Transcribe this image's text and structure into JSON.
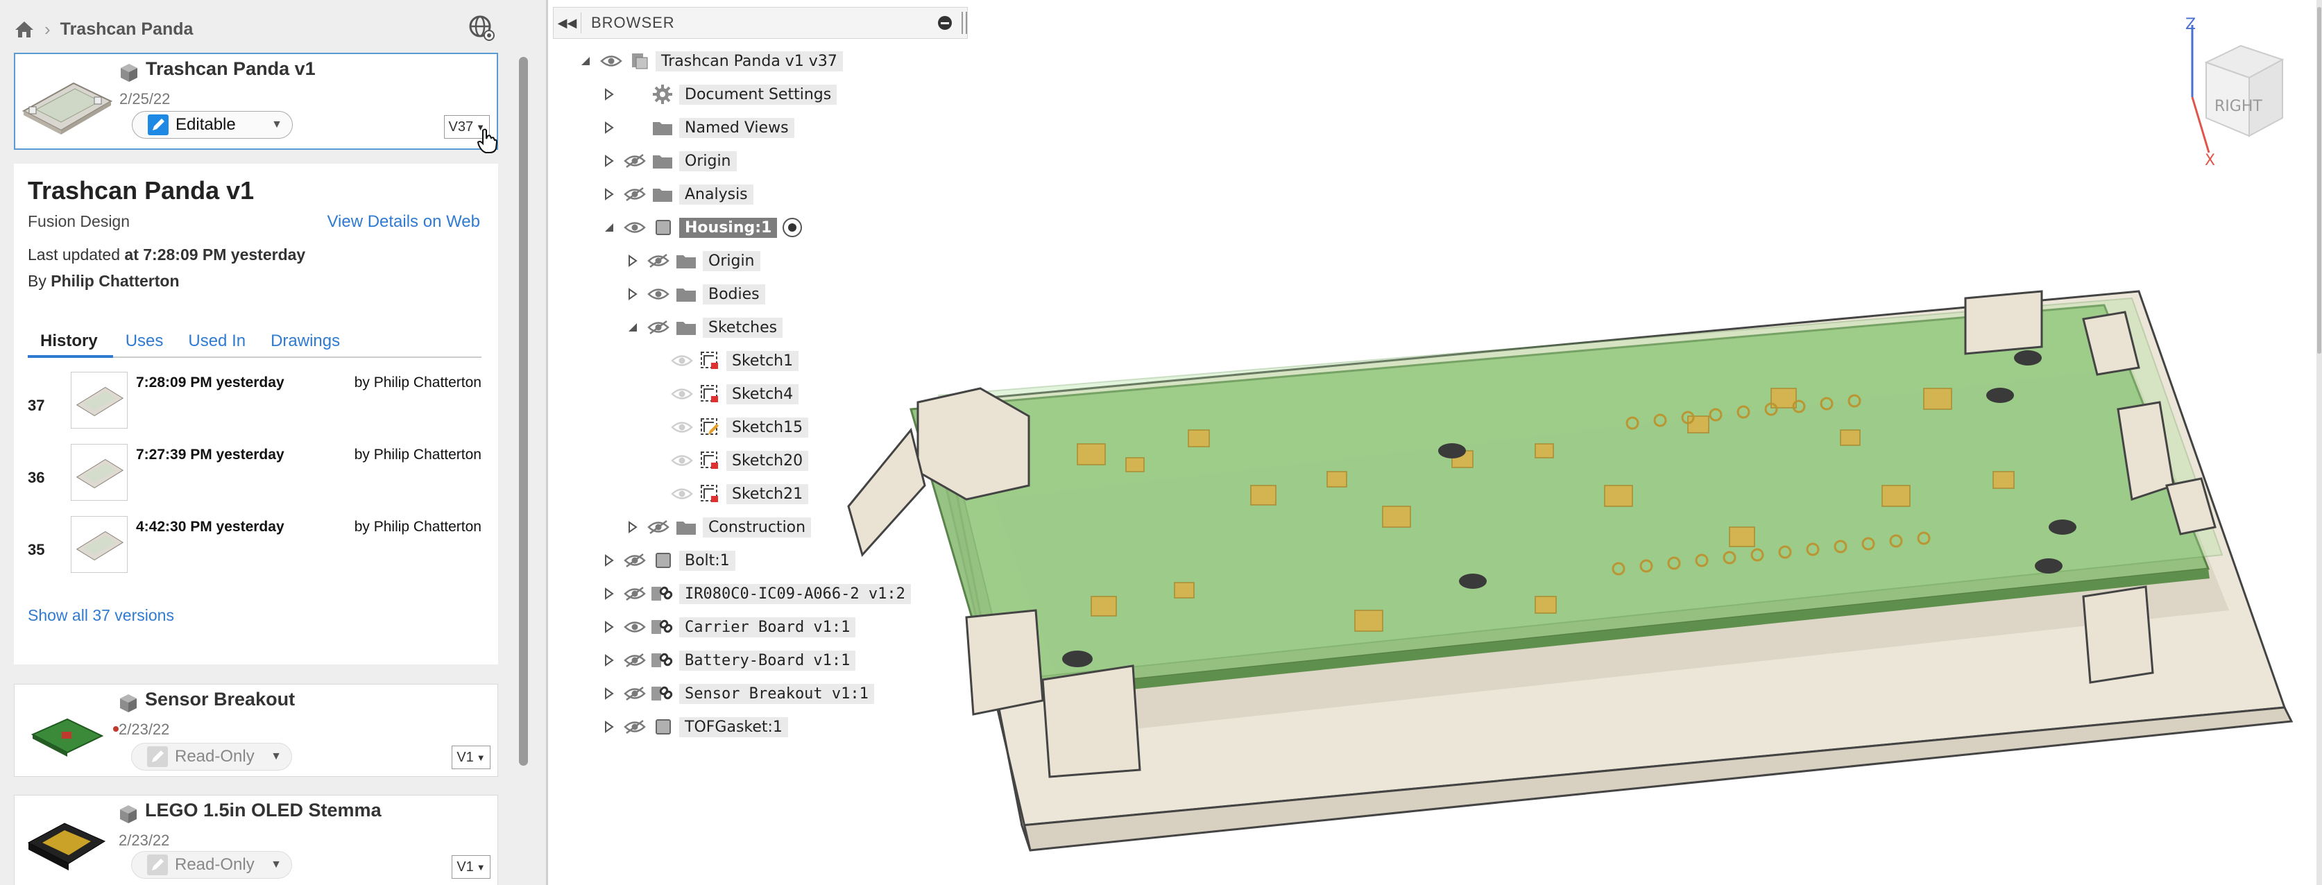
{
  "breadcrumb": {
    "home_icon": "home-icon",
    "current": "Trashcan Panda"
  },
  "header": {
    "globe_icon": "globe-icon"
  },
  "selected_card": {
    "title": "Trashcan Panda v1",
    "date": "2/25/22",
    "status": "Editable",
    "version": "V37"
  },
  "details": {
    "title": "Trashcan Panda v1",
    "type": "Fusion Design",
    "view_link": "View Details on Web",
    "updated_prefix": "Last updated",
    "updated_time": "at 7:28:09 PM yesterday",
    "by_prefix": "By",
    "by_name": "Philip Chatterton",
    "tabs": [
      "History",
      "Uses",
      "Used In",
      "Drawings"
    ],
    "history": [
      {
        "num": "37",
        "time": "7:28:09 PM yesterday",
        "by": "by Philip Chatterton"
      },
      {
        "num": "36",
        "time": "7:27:39 PM yesterday",
        "by": "by Philip Chatterton"
      },
      {
        "num": "35",
        "time": "4:42:30 PM yesterday",
        "by": "by Philip Chatterton"
      }
    ],
    "show_all": "Show all 37 versions"
  },
  "cards": [
    {
      "title": "Sensor Breakout",
      "date": "2/23/22",
      "status": "Read-Only",
      "version": "V1"
    },
    {
      "title": "LEGO 1.5in OLED Stemma",
      "date": "2/23/22",
      "status": "Read-Only",
      "version": "V1"
    }
  ],
  "browser": {
    "label": "BROWSER",
    "collapse_icon": "double-chevron-left-icon",
    "nodes": [
      {
        "label": "Trashcan Panda v1 v37"
      },
      {
        "label": "Document Settings"
      },
      {
        "label": "Named Views"
      },
      {
        "label": "Origin"
      },
      {
        "label": "Analysis"
      },
      {
        "label": "Housing:1"
      },
      {
        "label": "Origin"
      },
      {
        "label": "Bodies"
      },
      {
        "label": "Sketches"
      },
      {
        "label": "Sketch1"
      },
      {
        "label": "Sketch4"
      },
      {
        "label": "Sketch15"
      },
      {
        "label": "Sketch20"
      },
      {
        "label": "Sketch21"
      },
      {
        "label": "Construction"
      },
      {
        "label": "Bolt:1"
      },
      {
        "label": "IR080C0-IC09-A066-2 v1:2"
      },
      {
        "label": "Carrier Board v1:1"
      },
      {
        "label": "Battery-Board v1:1"
      },
      {
        "label": "Sensor Breakout v1:1"
      },
      {
        "label": "TOFGasket:1"
      }
    ]
  },
  "viewcube": {
    "face": "RIGHT",
    "axis_z": "Z",
    "axis_x": "X"
  },
  "colors": {
    "accent": "#2f7bd1",
    "pcb": "#8fbf7a",
    "housing": "#ede6d8",
    "selection": "#7d7d7d"
  }
}
